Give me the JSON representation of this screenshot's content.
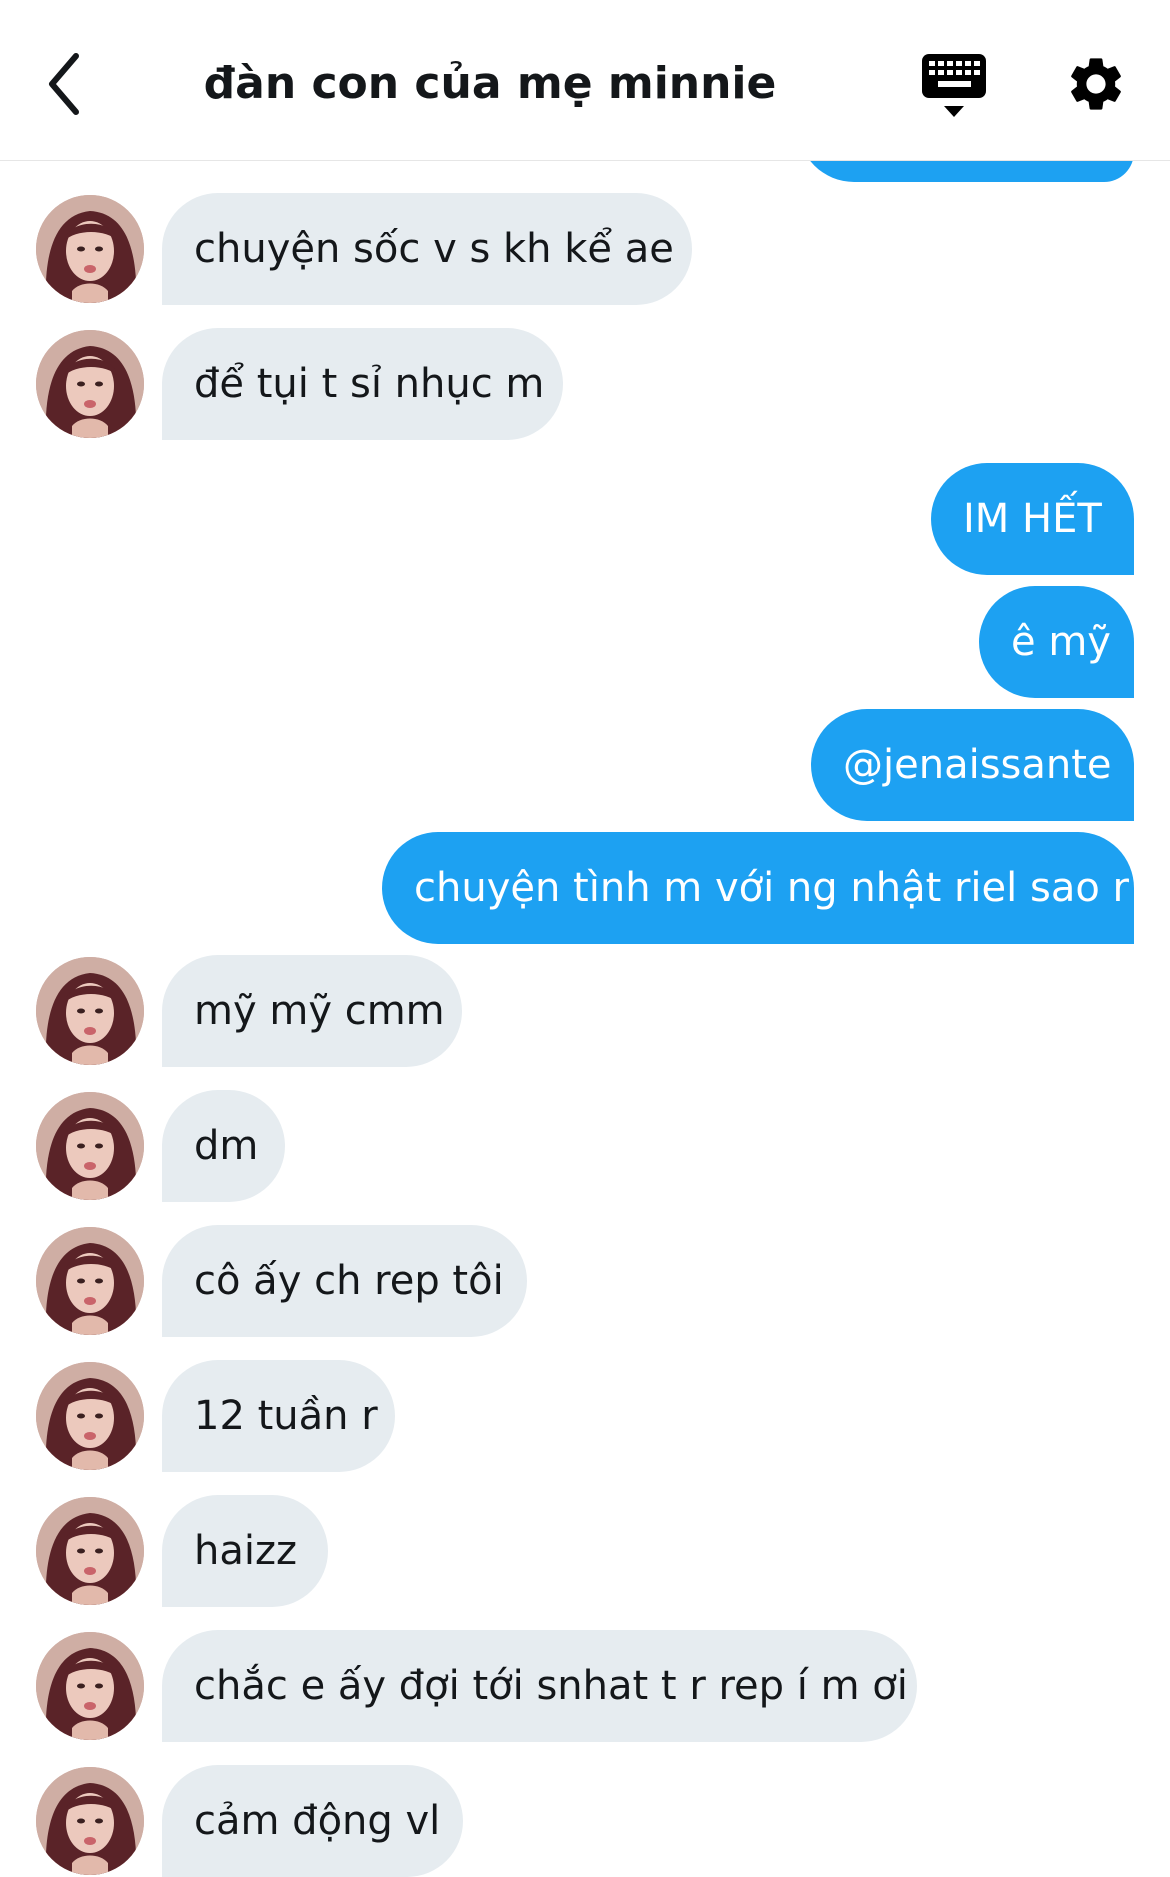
{
  "header": {
    "title": "đàn con của mẹ minnie",
    "back_icon": "chevron-left-icon",
    "keyboard_icon": "keyboard-icon",
    "settings_icon": "gear-icon"
  },
  "colors": {
    "outgoing": "#1da1f2",
    "incoming": "#e6ecf0",
    "text_dark": "#14171a"
  },
  "messages": [
    {
      "side": "in",
      "text": "chuyện sốc v s kh kể ae"
    },
    {
      "side": "in",
      "text": "để tụi t sỉ nhục m"
    },
    {
      "side": "out",
      "text": "IM HẾT"
    },
    {
      "side": "out",
      "text": "ê mỹ"
    },
    {
      "side": "out",
      "text": "@jenaissante"
    },
    {
      "side": "out",
      "text": "chuyện tình m với ng nhật riel sao r"
    },
    {
      "side": "in",
      "text": "mỹ mỹ cmm"
    },
    {
      "side": "in",
      "text": "dm"
    },
    {
      "side": "in",
      "text": "cô ấy ch rep tôi"
    },
    {
      "side": "in",
      "text": "12 tuần r"
    },
    {
      "side": "in",
      "text": "haizz"
    },
    {
      "side": "in",
      "text": "chắc e ấy đợi tới snhat t r rep í m ơi"
    },
    {
      "side": "in",
      "text": "cảm động vl"
    }
  ]
}
